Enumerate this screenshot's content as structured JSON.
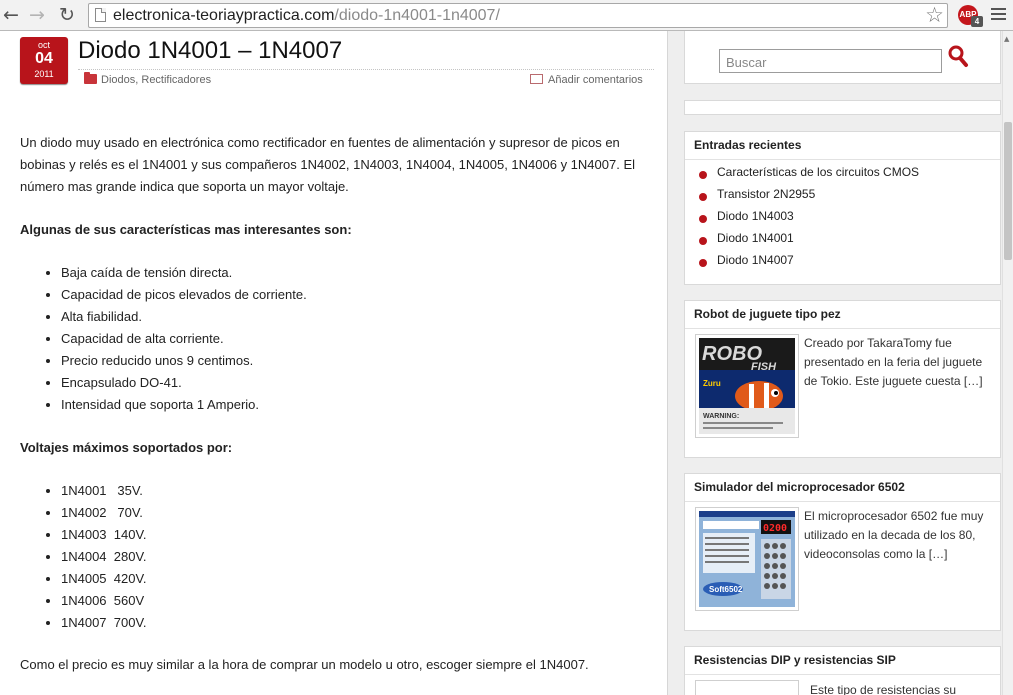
{
  "browser": {
    "url_host": "electronica-teoriaypractica.com",
    "url_path": "/diodo-1n4001-1n4007/",
    "adblock_label": "ABP",
    "adblock_count": "4"
  },
  "post": {
    "date_month": "oct",
    "date_day": "04",
    "date_year": "2011",
    "title": "Diodo 1N4001 – 1N4007",
    "category_1": "Diodos",
    "category_separator": ", ",
    "category_2": "Rectificadores",
    "comments_link": "Añadir comentarios",
    "intro": "Un diodo muy usado en electrónica como rectificador en fuentes de alimentación y supresor de picos en bobinas y relés es el 1N4001 y sus compañeros 1N4002, 1N4003, 1N4004, 1N4005, 1N4006 y 1N4007. El número mas grande indica que soporta un mayor voltaje.",
    "features_heading": "Algunas de sus características mas interesantes son:",
    "features": [
      "Baja caída de tensión directa.",
      "Capacidad de picos elevados de corriente.",
      "Alta fiabilidad.",
      "Capacidad de alta corriente.",
      "Precio reducido unos 9 centimos.",
      "Encapsulado DO-41.",
      "Intensidad que soporta 1 Amperio."
    ],
    "voltages_heading": "Voltajes máximos soportados por:",
    "voltages": [
      "1N4001   35V.",
      "1N4002   70V.",
      "1N4003  140V.",
      "1N4004  280V.",
      "1N4005  420V.",
      "1N4006  560V",
      "1N4007  700V."
    ],
    "conclusion": "Como el precio es muy similar a la hora de comprar un modelo u otro, escoger siempre el 1N4007."
  },
  "sidebar": {
    "search_placeholder": "Buscar",
    "recent_title": "Entradas recientes",
    "recent_items": [
      "Características de los circuitos CMOS",
      "Transistor 2N2955",
      "Diodo 1N4003",
      "Diodo 1N4001",
      "Diodo 1N4007"
    ],
    "featured": [
      {
        "title": "Robot de juguete tipo pez",
        "excerpt": "Creado por TakaraTomy fue presentado en la feria del juguete de Tokio. Este juguete cuesta […]",
        "thumb_text_1": "ROBO",
        "thumb_text_2": "FISH",
        "thumb_brand": "Zuru",
        "thumb_warning": "WARNING:"
      },
      {
        "title": "Simulador del microprocesador 6502",
        "excerpt": "El microprocesador 6502 fue muy utilizado en la decada de los 80, videoconsolas como la […]",
        "thumb_display": "0200",
        "thumb_logo": "Soft6502"
      },
      {
        "title": "Resistencias DIP y resistencias SIP",
        "excerpt": "Este tipo de resistencias su"
      }
    ]
  },
  "colors": {
    "accent": "#b8141b",
    "sidebar_bg": "#eeeeee",
    "text": "#222222"
  }
}
